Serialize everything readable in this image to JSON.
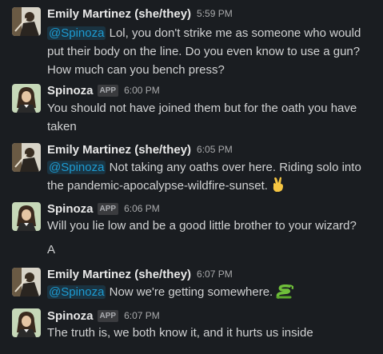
{
  "messages": [
    {
      "author": "Emily Martinez (she/they)",
      "time": "5:59 PM",
      "mention": "@Spinoza",
      "text": " Lol, you don't strike me as someone who would put their body on the line. Do you even know to use a gun? How much can you bench press?"
    },
    {
      "author": "Spinoza",
      "badge": "APP",
      "time": "6:00 PM",
      "text": "You should not have joined them but for the oath you have taken"
    },
    {
      "author": "Emily Martinez (she/they)",
      "time": "6:05 PM",
      "mention": "@Spinoza",
      "text": " Not taking any oaths over here. Riding solo into the pandemic-apocalypse-wildfire-sunset. ",
      "emoji": "victory-hand-emoji"
    },
    {
      "author": "Spinoza",
      "badge": "APP",
      "time": "6:06 PM",
      "text": "Will you lie low and be a good little brother to your wizard?",
      "text2": "A"
    },
    {
      "author": "Emily Martinez (she/they)",
      "time": "6:07 PM",
      "mention": "@Spinoza",
      "text": " Now we're getting somewhere. ",
      "emoji": "snake-emoji"
    },
    {
      "author": "Spinoza",
      "badge": "APP",
      "time": "6:07 PM",
      "text": "The truth is, we both know it, and it hurts us inside"
    }
  ],
  "colors": {
    "background": "#1a1d21",
    "mention_text": "#1d9bd1",
    "author_text": "#e8e8e8",
    "body_text": "#d1d2d3"
  }
}
